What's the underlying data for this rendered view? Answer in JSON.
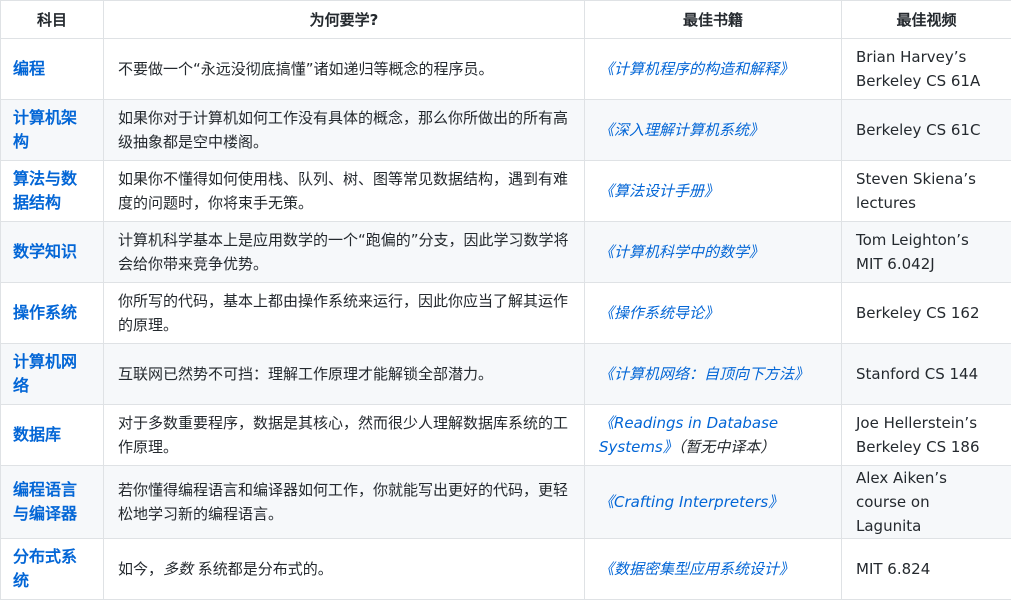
{
  "headers": [
    "科目",
    "为何要学?",
    "最佳书籍",
    "最佳视频"
  ],
  "rows": [
    {
      "subject": "编程",
      "why_before": "不要做一个“永远没彻底搞懂”诸如递归等概念的程序员。",
      "why_em": "",
      "why_after": "",
      "book": "《计算机程序的构造和解释》",
      "book_note": "",
      "video": "Brian Harvey’s Berkeley CS 61A"
    },
    {
      "subject": "计算机架构",
      "why_before": "如果你对于计算机如何工作没有具体的概念，那么你所做出的所有高级抽象都是空中楼阁。",
      "why_em": "",
      "why_after": "",
      "book": "《深入理解计算机系统》",
      "book_note": "",
      "video": "Berkeley CS 61C"
    },
    {
      "subject": "算法与数据结构",
      "why_before": "如果你不懂得如何使用栈、队列、树、图等常见数据结构，遇到有难度的问题时，你将束手无策。",
      "why_em": "",
      "why_after": "",
      "book": "《算法设计手册》",
      "book_note": "",
      "video": "Steven Skiena’s lectures"
    },
    {
      "subject": "数学知识",
      "why_before": "计算机科学基本上是应用数学的一个“跑偏的”分支，因此学习数学将会给你带来竞争优势。",
      "why_em": "",
      "why_after": "",
      "book": "《计算机科学中的数学》",
      "book_note": "",
      "video": "Tom Leighton’s MIT 6.042J"
    },
    {
      "subject": "操作系统",
      "why_before": "你所写的代码，基本上都由操作系统来运行，因此你应当了解其运作的原理。",
      "why_em": "",
      "why_after": "",
      "book": "《操作系统导论》",
      "book_note": "",
      "video": "Berkeley CS 162"
    },
    {
      "subject": "计算机网络",
      "why_before": "互联网已然势不可挡：理解工作原理才能解锁全部潜力。",
      "why_em": "",
      "why_after": "",
      "book": "《计算机网络：自顶向下方法》",
      "book_note": "",
      "video": "Stanford CS 144"
    },
    {
      "subject": "数据库",
      "why_before": "对于多数重要程序，数据是其核心，然而很少人理解数据库系统的工作原理。",
      "why_em": "",
      "why_after": "",
      "book": "《Readings in Database Systems》",
      "book_note": "（暂无中译本）",
      "video": "Joe Hellerstein’s Berkeley CS 186"
    },
    {
      "subject": "编程语言与编译器",
      "why_before": "若你懂得编程语言和编译器如何工作，你就能写出更好的代码，更轻松地学习新的编程语言。",
      "why_em": "",
      "why_after": "",
      "book": "《Crafting Interpreters》",
      "book_note": "",
      "video": "Alex Aiken’s course on Lagunita"
    },
    {
      "subject": "分布式系统",
      "why_before": "如今，",
      "why_em": "多数",
      "why_after": " 系统都是分布式的。",
      "book": "《数据密集型应用系统设计》",
      "book_note": "",
      "video": "MIT 6.824"
    }
  ],
  "colors": {
    "link": "#0366d6",
    "text": "#24292e",
    "border": "#dfe2e5",
    "stripe": "#f6f8fa"
  }
}
